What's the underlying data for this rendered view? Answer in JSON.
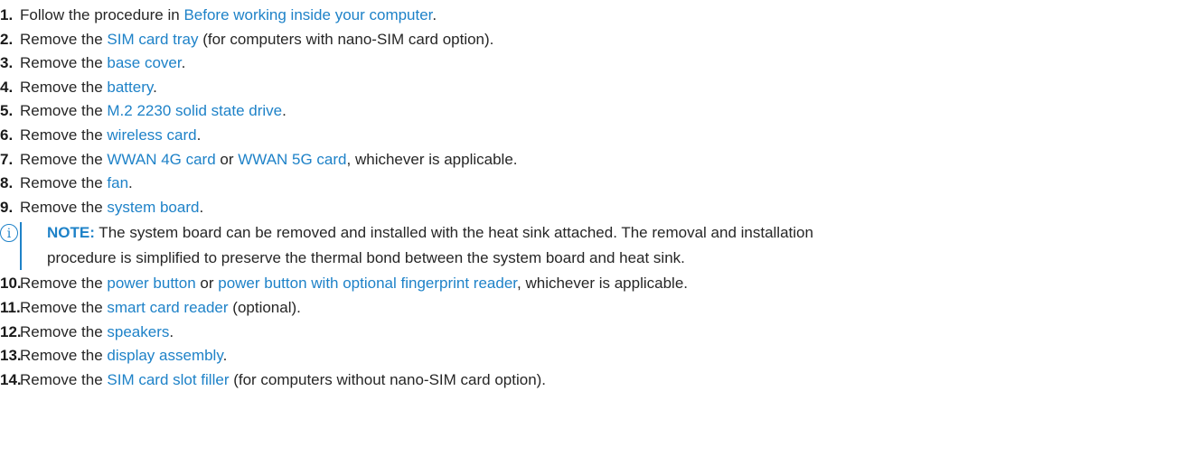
{
  "steps": [
    {
      "num": "1.",
      "pre": "Follow the procedure in ",
      "link": "Before working inside your computer",
      "post": "."
    },
    {
      "num": "2.",
      "pre": "Remove the ",
      "link": "SIM card tray",
      "post": " (for computers with nano-SIM card option)."
    },
    {
      "num": "3.",
      "pre": "Remove the ",
      "link": "base cover",
      "post": "."
    },
    {
      "num": "4.",
      "pre": "Remove the ",
      "link": "battery",
      "post": "."
    },
    {
      "num": "5.",
      "pre": "Remove the ",
      "link": "M.2 2230 solid state drive",
      "post": "."
    },
    {
      "num": "6.",
      "pre": "Remove the ",
      "link": "wireless card",
      "post": "."
    },
    {
      "num": "7.",
      "pre": "Remove the ",
      "link": "WWAN 4G card",
      "mid": " or ",
      "link2": "WWAN 5G card",
      "post": ", whichever is applicable."
    },
    {
      "num": "8.",
      "pre": "Remove the ",
      "link": "fan",
      "post": "."
    },
    {
      "num": "9.",
      "pre": "Remove the ",
      "link": "system board",
      "post": "."
    },
    {
      "num": "10.",
      "pre": "Remove the ",
      "link": "power button",
      "mid": " or ",
      "link2": "power button with optional fingerprint reader",
      "post": ", whichever is applicable."
    },
    {
      "num": "11.",
      "pre": "Remove the ",
      "link": "smart card reader",
      "post": " (optional)."
    },
    {
      "num": "12.",
      "pre": "Remove the ",
      "link": "speakers",
      "post": "."
    },
    {
      "num": "13.",
      "pre": "Remove the ",
      "link": "display assembly",
      "post": "."
    },
    {
      "num": "14.",
      "pre": "Remove the ",
      "link": "SIM card slot filler",
      "post": " (for computers without nano-SIM card option)."
    }
  ],
  "note": {
    "label": "NOTE:",
    "line1": " The system board can be removed and installed with the heat sink attached. The removal and installation",
    "line2": "procedure is simplified to preserve the thermal bond between the system board and heat sink.",
    "icon": "info-icon",
    "icon_glyph": "i"
  },
  "colors": {
    "link": "#1e82c8",
    "text": "#262626"
  }
}
